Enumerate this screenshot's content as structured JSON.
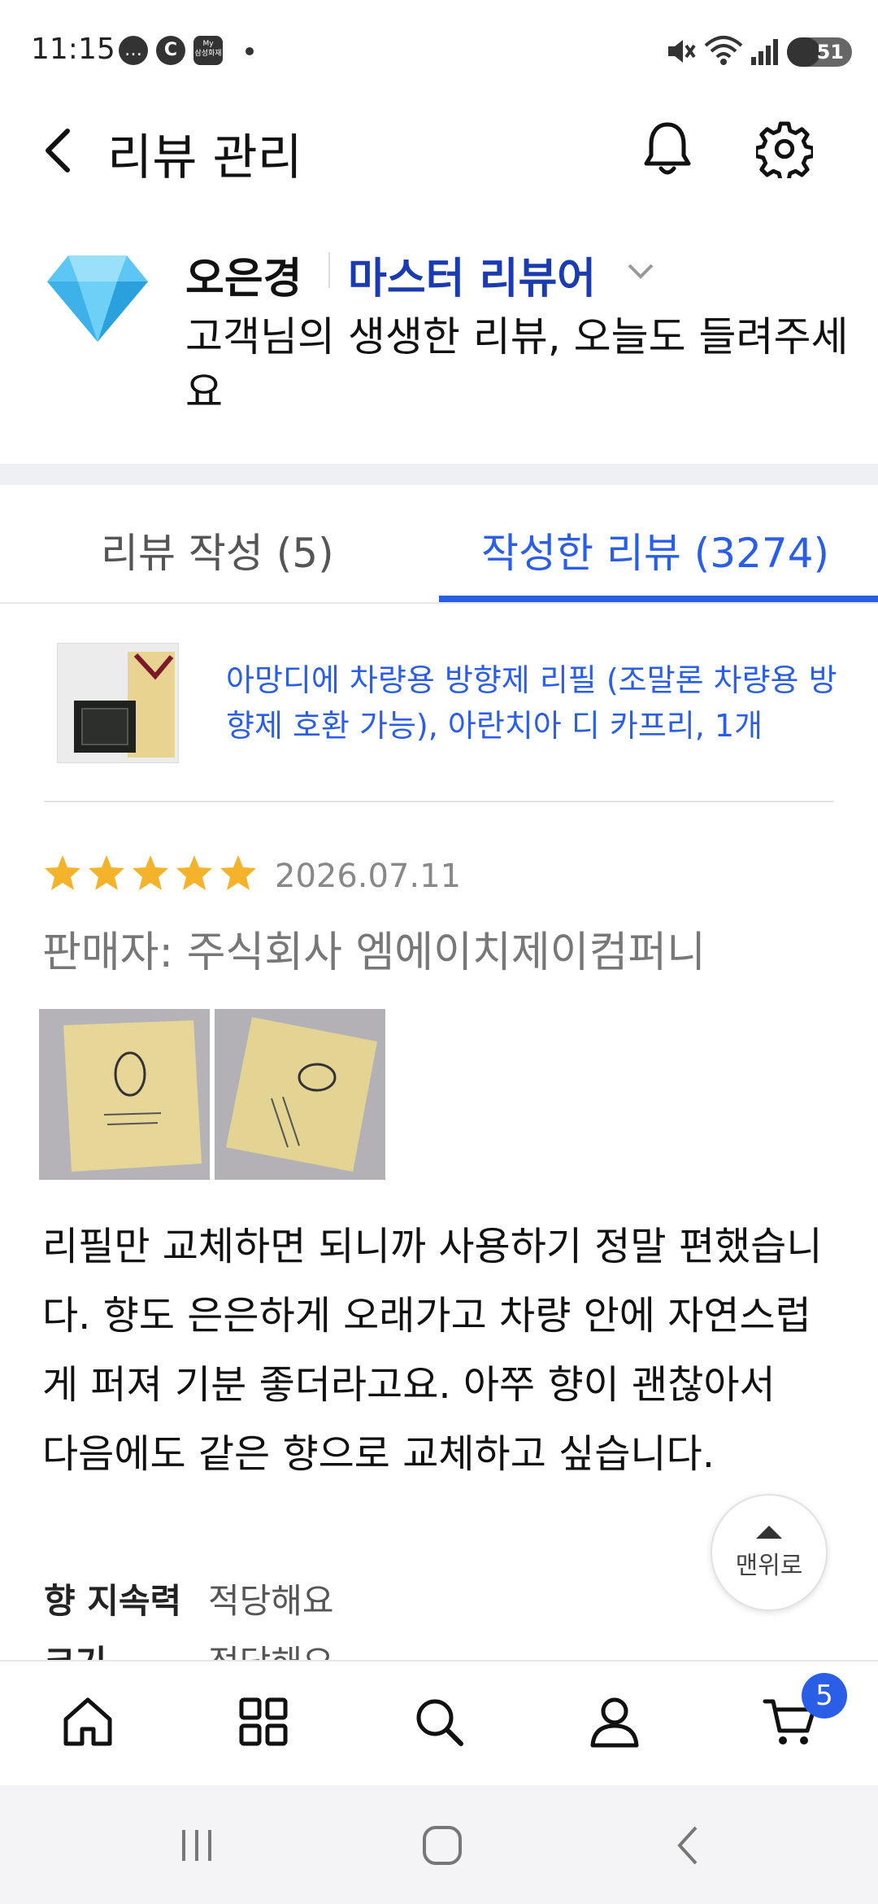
{
  "status_bar": {
    "time": "11:15",
    "icons": [
      "chat-icon",
      "c-icon",
      "samsung-pay-icon",
      "dot-icon"
    ],
    "notif_c": "C",
    "notif_pay": "My\n삼성화재",
    "battery_level": "51",
    "battery_fraction": 0.51,
    "indicators": [
      "mute-icon",
      "wifi-icon",
      "signal-icon",
      "battery-icon"
    ]
  },
  "header": {
    "title": "리뷰 관리",
    "back_icon": "chevron-left-icon",
    "bell_icon": "bell-icon",
    "settings_icon": "gear-icon"
  },
  "profile": {
    "name": "오은경",
    "rank": "마스터 리뷰어",
    "message": "고객님의 생생한 리뷰, 오늘도 들려주세요",
    "badge_icon": "diamond-icon"
  },
  "tabs": [
    {
      "label": "리뷰 작성 (5)",
      "active": false
    },
    {
      "label": "작성한 리뷰 (3274)",
      "active": true
    }
  ],
  "product": {
    "name": "아망디에 차량용 방향제 리필 (조말론 차량용 방향제 호환 가능), 아란치아 디 카프리, 1개"
  },
  "review": {
    "rating": 5,
    "rating_max": 5,
    "date": "2026.07.11",
    "seller": "판매자: 주식회사 엠에이치제이컴퍼니",
    "body": "리필만 교체하면 되니까 사용하기 정말 편했습니다. 향도 은은하게 오래가고 차량 안에 자연스럽게 퍼져 기분 좋더라고요. 아쭈 향이 괜찮아서 다음에도 같은 향으로 교체하고 싶습니다.",
    "attributes": [
      {
        "label": "향 지속력",
        "value": "적당해요"
      },
      {
        "label": "크기",
        "value": "적당해요"
      }
    ]
  },
  "top_button": {
    "label": "맨위로"
  },
  "bottom_nav": {
    "items": [
      "home-icon",
      "grid-icon",
      "search-icon",
      "person-icon",
      "cart-icon"
    ],
    "cart_count": "5"
  },
  "colors": {
    "accent": "#2b5ee6",
    "rank": "#1b3bb0",
    "star": "#f5b32b"
  }
}
